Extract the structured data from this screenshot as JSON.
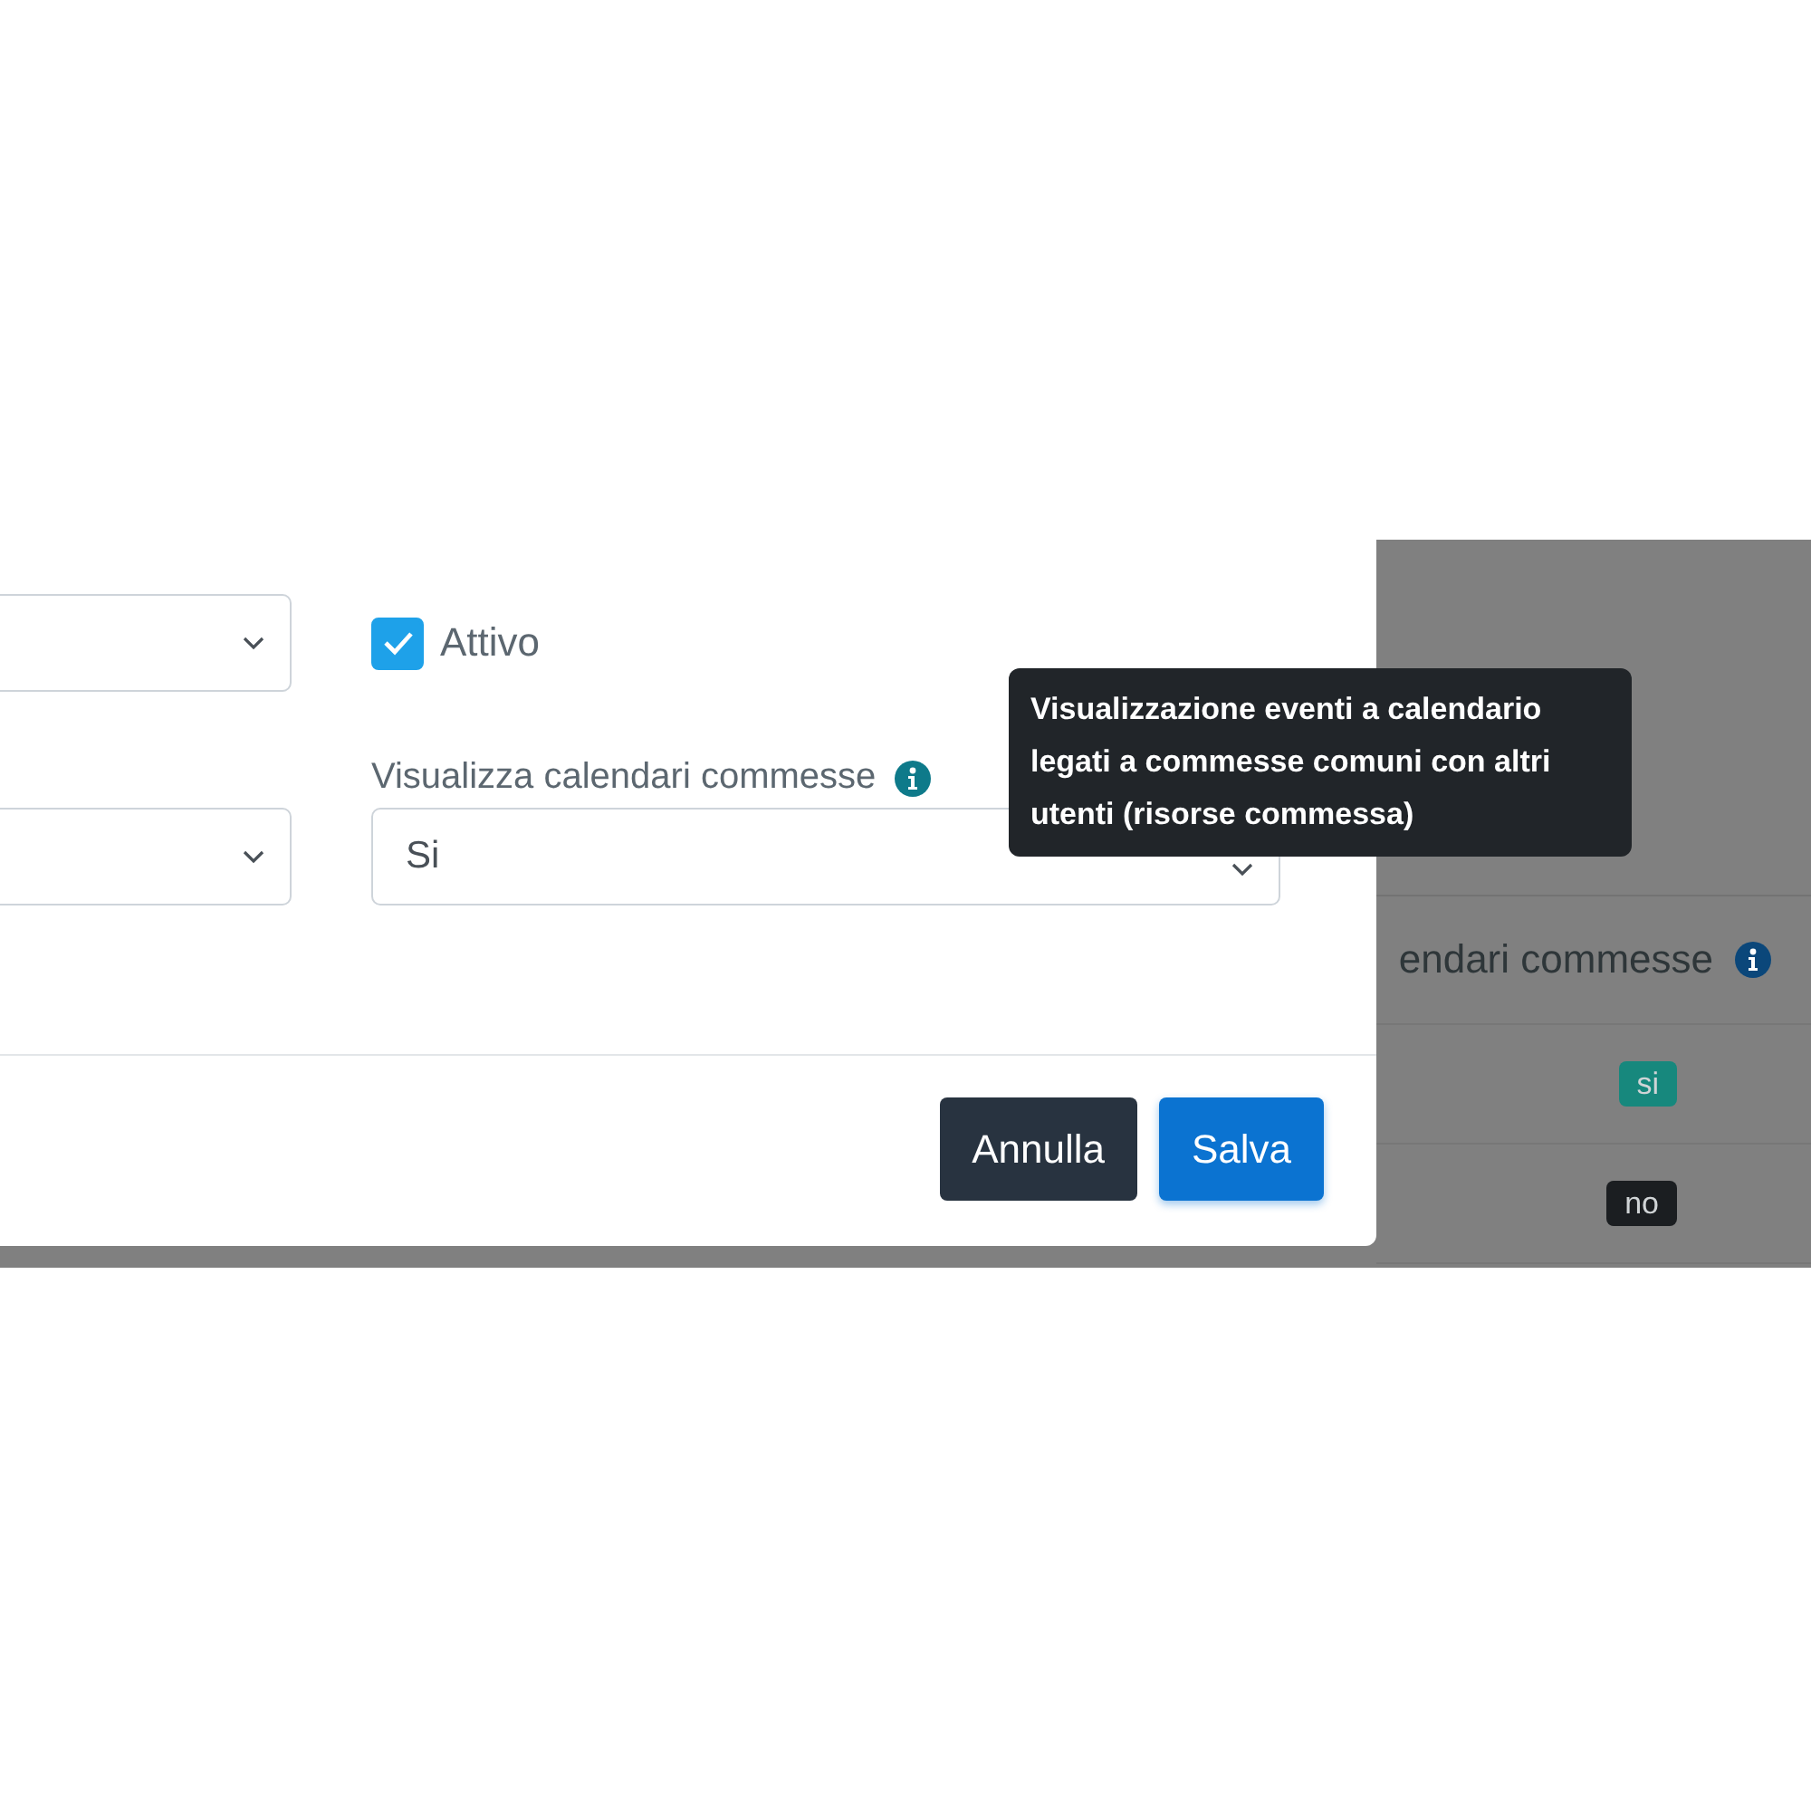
{
  "modal": {
    "rows": [
      {
        "left": {
          "kind": "select"
        },
        "right": {
          "kind": "checkbox",
          "label": "Attivo",
          "checked": true
        }
      },
      {
        "left": {
          "kind": "select"
        },
        "right": {
          "kind": "select",
          "label": "Visualizza calendari commesse",
          "info": true,
          "value": "Si"
        }
      }
    ],
    "buttons": [
      {
        "label": "Annulla",
        "kind": "secondary"
      },
      {
        "label": "Salva",
        "kind": "primary"
      }
    ]
  },
  "tooltip": {
    "text": "Visualizzazione eventi a calendario legati a commesse comuni con altri utenti (risorse commessa)"
  },
  "background_table": {
    "header": "endari commesse",
    "info": true,
    "rows": [
      {
        "badge": "si",
        "color": "#17887d"
      },
      {
        "badge": "no",
        "color": "#1b1e21"
      }
    ]
  }
}
